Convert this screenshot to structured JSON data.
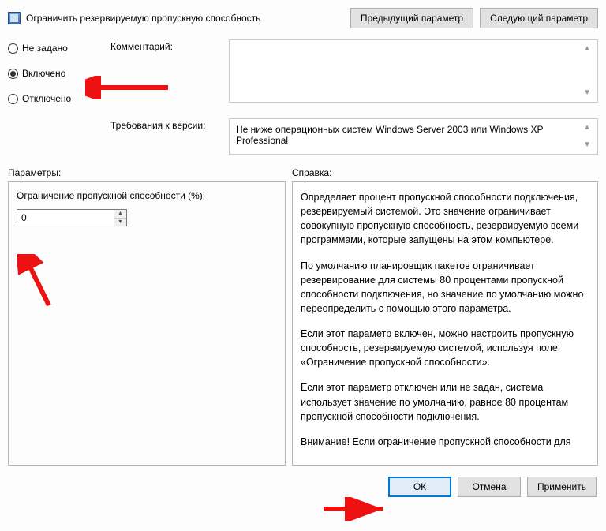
{
  "header": {
    "title": "Ограничить резервируемую пропускную способность",
    "prev_btn": "Предыдущий параметр",
    "next_btn": "Следующий параметр"
  },
  "state": {
    "not_configured": "Не задано",
    "enabled": "Включено",
    "disabled": "Отключено",
    "selected": "enabled"
  },
  "meta": {
    "comment_label": "Комментарий:",
    "comment_value": "",
    "req_label": "Требования к версии:",
    "req_value": "Не ниже операционных систем Windows Server 2003 или Windows XP Professional"
  },
  "sections": {
    "options_label": "Параметры:",
    "help_label": "Справка:"
  },
  "options": {
    "bandwidth_label": "Ограничение пропускной способности (%):",
    "bandwidth_value": "0"
  },
  "help": {
    "p1": "Определяет процент пропускной способности подключения, резервируемый системой. Это значение ограничивает совокупную пропускную способность, резервируемую всеми программами, которые запущены на этом компьютере.",
    "p2": "По умолчанию планировщик пакетов ограничивает резервирование для системы 80 процентами пропускной способности подключения, но значение по умолчанию можно переопределить с помощью этого параметра.",
    "p3": "Если этот параметр включен, можно настроить пропускную способность, резервируемую системой, используя поле «Ограничение пропускной способности».",
    "p4": "Если этот параметр отключен или не задан, система использует значение по умолчанию, равное 80 процентам пропускной способности подключения.",
    "p5": "Внимание! Если ограничение пропускной способности для"
  },
  "footer": {
    "ok": "ОК",
    "cancel": "Отмена",
    "apply": "Применить"
  }
}
